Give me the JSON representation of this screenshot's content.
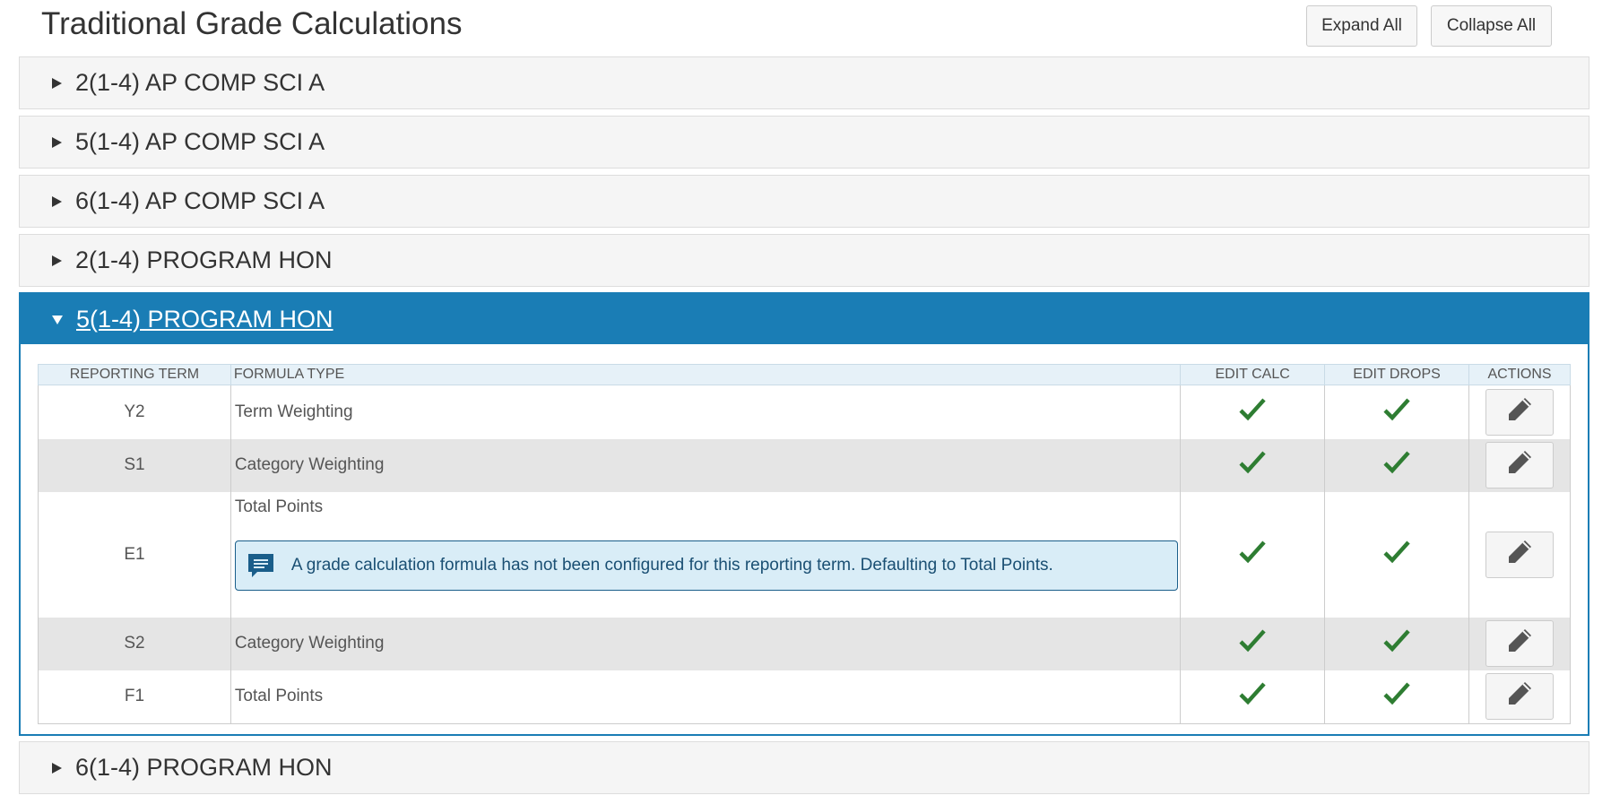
{
  "page": {
    "title": "Traditional Grade Calculations",
    "expand_all": "Expand All",
    "collapse_all": "Collapse All"
  },
  "colors": {
    "accent": "#1a7db5",
    "check": "#2e7d32",
    "notice_bg": "#d9edf7"
  },
  "sections": [
    {
      "label": "2(1-4) AP COMP SCI A",
      "expanded": false
    },
    {
      "label": "5(1-4) AP COMP SCI A",
      "expanded": false
    },
    {
      "label": "6(1-4) AP COMP SCI A",
      "expanded": false
    },
    {
      "label": "2(1-4) PROGRAM HON",
      "expanded": false
    },
    {
      "label": "5(1-4) PROGRAM HON",
      "expanded": true
    },
    {
      "label": "6(1-4) PROGRAM HON",
      "expanded": false
    }
  ],
  "table": {
    "headers": {
      "term": "REPORTING TERM",
      "formula": "FORMULA TYPE",
      "edit_calc": "EDIT CALC",
      "edit_drops": "EDIT DROPS",
      "actions": "ACTIONS"
    },
    "rows": [
      {
        "term": "Y2",
        "formula": "Term Weighting",
        "edit_calc": true,
        "edit_drops": true
      },
      {
        "term": "S1",
        "formula": "Category Weighting",
        "edit_calc": true,
        "edit_drops": true
      },
      {
        "term": "E1",
        "formula": "Total Points",
        "edit_calc": true,
        "edit_drops": true
      },
      {
        "term": "S2",
        "formula": "Category Weighting",
        "edit_calc": true,
        "edit_drops": true
      },
      {
        "term": "F1",
        "formula": "Total Points",
        "edit_calc": true,
        "edit_drops": true
      }
    ],
    "notice": "A grade calculation formula has not been configured for this reporting term. Defaulting to Total Points."
  },
  "icons": {
    "collapsed": "caret-right-icon",
    "expanded": "caret-down-icon",
    "check": "checkmark-icon",
    "edit": "pencil-icon",
    "notice": "comment-icon"
  }
}
